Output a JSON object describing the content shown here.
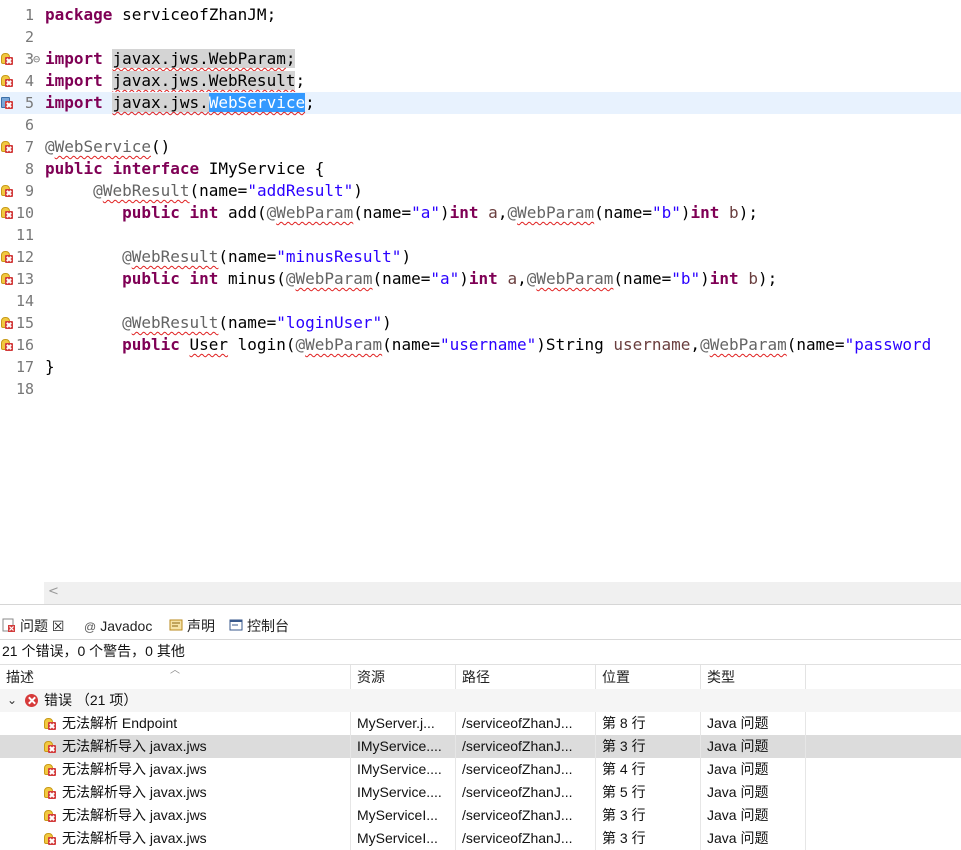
{
  "editor": {
    "lines": [
      {
        "num": "1",
        "marker": "",
        "fold": "",
        "highlight": false,
        "tokens": [
          {
            "t": "package",
            "c": "kw"
          },
          {
            "t": " serviceofZhanJM;",
            "c": ""
          }
        ]
      },
      {
        "num": "2",
        "marker": "",
        "fold": "",
        "highlight": false,
        "tokens": []
      },
      {
        "num": "3",
        "marker": "error",
        "fold": "⊖",
        "highlight": false,
        "tokens": [
          {
            "t": "import",
            "c": "kw"
          },
          {
            "t": " ",
            "c": ""
          },
          {
            "t": "javax.jws.WebParam",
            "c": "sq occ"
          },
          {
            "t": ";",
            "c": "occ"
          }
        ]
      },
      {
        "num": "4",
        "marker": "error",
        "fold": "",
        "highlight": false,
        "tokens": [
          {
            "t": "import",
            "c": "kw"
          },
          {
            "t": " ",
            "c": ""
          },
          {
            "t": "javax.jws.WebResult",
            "c": "sq occ"
          },
          {
            "t": ";",
            "c": ""
          }
        ]
      },
      {
        "num": "5",
        "marker": "bookmark",
        "fold": "",
        "highlight": true,
        "tokens": [
          {
            "t": "import",
            "c": "kw"
          },
          {
            "t": " ",
            "c": ""
          },
          {
            "t": "javax.jws.",
            "c": "sq occ"
          },
          {
            "t": "WebService",
            "c": "sq sel"
          },
          {
            "t": ";",
            "c": ""
          }
        ]
      },
      {
        "num": "6",
        "marker": "",
        "fold": "",
        "highlight": false,
        "tokens": []
      },
      {
        "num": "7",
        "marker": "error",
        "fold": "",
        "highlight": false,
        "tokens": [
          {
            "t": "@",
            "c": "ann"
          },
          {
            "t": "WebService",
            "c": "ann sq"
          },
          {
            "t": "()",
            "c": ""
          }
        ]
      },
      {
        "num": "8",
        "marker": "",
        "fold": "",
        "highlight": false,
        "tokens": [
          {
            "t": "public",
            "c": "kw"
          },
          {
            "t": " ",
            "c": ""
          },
          {
            "t": "interface",
            "c": "kw"
          },
          {
            "t": " IMyService {",
            "c": ""
          }
        ]
      },
      {
        "num": "9",
        "marker": "error",
        "fold": "",
        "highlight": false,
        "tokens": [
          {
            "t": "     ",
            "c": ""
          },
          {
            "t": "@",
            "c": "ann"
          },
          {
            "t": "WebResult",
            "c": "ann sq"
          },
          {
            "t": "(name=",
            "c": ""
          },
          {
            "t": "\"addResult\"",
            "c": "str"
          },
          {
            "t": ")",
            "c": ""
          }
        ]
      },
      {
        "num": "10",
        "marker": "error",
        "fold": "",
        "highlight": false,
        "tokens": [
          {
            "t": "        ",
            "c": ""
          },
          {
            "t": "public",
            "c": "kw"
          },
          {
            "t": " ",
            "c": ""
          },
          {
            "t": "int",
            "c": "kw"
          },
          {
            "t": " add(",
            "c": ""
          },
          {
            "t": "@",
            "c": "ann"
          },
          {
            "t": "WebParam",
            "c": "ann sq"
          },
          {
            "t": "(name=",
            "c": ""
          },
          {
            "t": "\"a\"",
            "c": "str"
          },
          {
            "t": ")",
            "c": ""
          },
          {
            "t": "int",
            "c": "kw"
          },
          {
            "t": " ",
            "c": ""
          },
          {
            "t": "a",
            "c": "var"
          },
          {
            "t": ",",
            "c": ""
          },
          {
            "t": "@",
            "c": "ann"
          },
          {
            "t": "WebParam",
            "c": "ann sq"
          },
          {
            "t": "(name=",
            "c": ""
          },
          {
            "t": "\"b\"",
            "c": "str"
          },
          {
            "t": ")",
            "c": ""
          },
          {
            "t": "int",
            "c": "kw"
          },
          {
            "t": " ",
            "c": ""
          },
          {
            "t": "b",
            "c": "var"
          },
          {
            "t": ");",
            "c": ""
          }
        ]
      },
      {
        "num": "11",
        "marker": "",
        "fold": "",
        "highlight": false,
        "tokens": []
      },
      {
        "num": "12",
        "marker": "error",
        "fold": "",
        "highlight": false,
        "tokens": [
          {
            "t": "        ",
            "c": ""
          },
          {
            "t": "@",
            "c": "ann"
          },
          {
            "t": "WebResult",
            "c": "ann sq"
          },
          {
            "t": "(name=",
            "c": ""
          },
          {
            "t": "\"minusResult\"",
            "c": "str"
          },
          {
            "t": ")",
            "c": ""
          }
        ]
      },
      {
        "num": "13",
        "marker": "error",
        "fold": "",
        "highlight": false,
        "tokens": [
          {
            "t": "        ",
            "c": ""
          },
          {
            "t": "public",
            "c": "kw"
          },
          {
            "t": " ",
            "c": ""
          },
          {
            "t": "int",
            "c": "kw"
          },
          {
            "t": " minus(",
            "c": ""
          },
          {
            "t": "@",
            "c": "ann"
          },
          {
            "t": "WebParam",
            "c": "ann sq"
          },
          {
            "t": "(name=",
            "c": ""
          },
          {
            "t": "\"a\"",
            "c": "str"
          },
          {
            "t": ")",
            "c": ""
          },
          {
            "t": "int",
            "c": "kw"
          },
          {
            "t": " ",
            "c": ""
          },
          {
            "t": "a",
            "c": "var"
          },
          {
            "t": ",",
            "c": ""
          },
          {
            "t": "@",
            "c": "ann"
          },
          {
            "t": "WebParam",
            "c": "ann sq"
          },
          {
            "t": "(name=",
            "c": ""
          },
          {
            "t": "\"b\"",
            "c": "str"
          },
          {
            "t": ")",
            "c": ""
          },
          {
            "t": "int",
            "c": "kw"
          },
          {
            "t": " ",
            "c": ""
          },
          {
            "t": "b",
            "c": "var"
          },
          {
            "t": ");",
            "c": ""
          }
        ]
      },
      {
        "num": "14",
        "marker": "",
        "fold": "",
        "highlight": false,
        "tokens": []
      },
      {
        "num": "15",
        "marker": "error",
        "fold": "",
        "highlight": false,
        "tokens": [
          {
            "t": "        ",
            "c": ""
          },
          {
            "t": "@",
            "c": "ann"
          },
          {
            "t": "WebResult",
            "c": "ann sq"
          },
          {
            "t": "(name=",
            "c": ""
          },
          {
            "t": "\"loginUser\"",
            "c": "str"
          },
          {
            "t": ")",
            "c": ""
          }
        ]
      },
      {
        "num": "16",
        "marker": "error",
        "fold": "",
        "highlight": false,
        "tokens": [
          {
            "t": "        ",
            "c": ""
          },
          {
            "t": "public",
            "c": "kw"
          },
          {
            "t": " ",
            "c": ""
          },
          {
            "t": "User",
            "c": "sq"
          },
          {
            "t": " login(",
            "c": ""
          },
          {
            "t": "@",
            "c": "ann"
          },
          {
            "t": "WebParam",
            "c": "ann sq"
          },
          {
            "t": "(name=",
            "c": ""
          },
          {
            "t": "\"username\"",
            "c": "str"
          },
          {
            "t": ")String ",
            "c": ""
          },
          {
            "t": "username",
            "c": "var"
          },
          {
            "t": ",",
            "c": ""
          },
          {
            "t": "@",
            "c": "ann"
          },
          {
            "t": "WebParam",
            "c": "ann sq"
          },
          {
            "t": "(name=",
            "c": ""
          },
          {
            "t": "\"password",
            "c": "str"
          }
        ]
      },
      {
        "num": "17",
        "marker": "",
        "fold": "",
        "highlight": false,
        "tokens": [
          {
            "t": "}",
            "c": ""
          }
        ]
      },
      {
        "num": "18",
        "marker": "",
        "fold": "",
        "highlight": false,
        "tokens": []
      }
    ],
    "hscroll_left": "<"
  },
  "tabs": [
    {
      "label": "问题 ☒",
      "icon": "problems-icon",
      "active": true
    },
    {
      "label": "Javadoc",
      "icon": "javadoc-icon",
      "active": false
    },
    {
      "label": "声明",
      "icon": "declaration-icon",
      "active": false
    },
    {
      "label": "控制台",
      "icon": "console-icon",
      "active": false
    }
  ],
  "summary": "21 个错误，0 个警告，0 其他",
  "columns": [
    "描述",
    "资源",
    "路径",
    "位置",
    "类型"
  ],
  "group": {
    "chevron": "⌄",
    "label": "错误 （21 项）"
  },
  "rows": [
    {
      "desc": "无法解析 Endpoint",
      "res": "MyServer.j...",
      "path": "/serviceofZhanJ...",
      "loc": "第 8 行",
      "type": "Java 问题",
      "selected": false
    },
    {
      "desc": "无法解析导入 javax.jws",
      "res": "IMyService....",
      "path": "/serviceofZhanJ...",
      "loc": "第 3 行",
      "type": "Java 问题",
      "selected": true
    },
    {
      "desc": "无法解析导入 javax.jws",
      "res": "IMyService....",
      "path": "/serviceofZhanJ...",
      "loc": "第 4 行",
      "type": "Java 问题",
      "selected": false
    },
    {
      "desc": "无法解析导入 javax.jws",
      "res": "IMyService....",
      "path": "/serviceofZhanJ...",
      "loc": "第 5 行",
      "type": "Java 问题",
      "selected": false
    },
    {
      "desc": "无法解析导入 javax.jws",
      "res": "MyServiceI...",
      "path": "/serviceofZhanJ...",
      "loc": "第 3 行",
      "type": "Java 问题",
      "selected": false
    },
    {
      "desc": "无法解析导入 javax.jws",
      "res": "MyServiceI...",
      "path": "/serviceofZhanJ...",
      "loc": "第 3 行",
      "type": "Java 问题",
      "selected": false
    }
  ],
  "colors": {
    "keyword": "#7f0055",
    "string": "#2a00ff",
    "annotation": "#646464",
    "selection": "#3399ff",
    "error": "#d23b3b"
  }
}
